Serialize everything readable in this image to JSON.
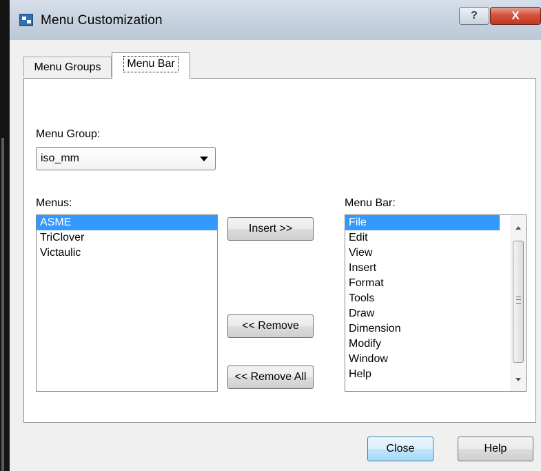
{
  "window": {
    "title": "Menu Customization",
    "help_button": "?",
    "close_button": "X"
  },
  "tabs": [
    {
      "label": "Menu Groups",
      "active": false
    },
    {
      "label": "Menu Bar",
      "active": true
    }
  ],
  "menu_group": {
    "label": "Menu Group:",
    "value": "iso_mm"
  },
  "menus": {
    "label": "Menus:",
    "items": [
      "ASME",
      "TriClover",
      "Victaulic"
    ],
    "selected_index": 0
  },
  "menu_bar": {
    "label": "Menu Bar:",
    "items": [
      "File",
      "Edit",
      "View",
      "Insert",
      "Format",
      "Tools",
      "Draw",
      "Dimension",
      "Modify",
      "Window",
      "Help"
    ],
    "selected_index": 0
  },
  "buttons": {
    "insert": "Insert >>",
    "remove": "<< Remove",
    "remove_all": "<< Remove All",
    "close": "Close",
    "help": "Help"
  },
  "colors": {
    "selection": "#3399ff",
    "titlebar": "#c8d3e0",
    "close_button": "#c23821"
  }
}
